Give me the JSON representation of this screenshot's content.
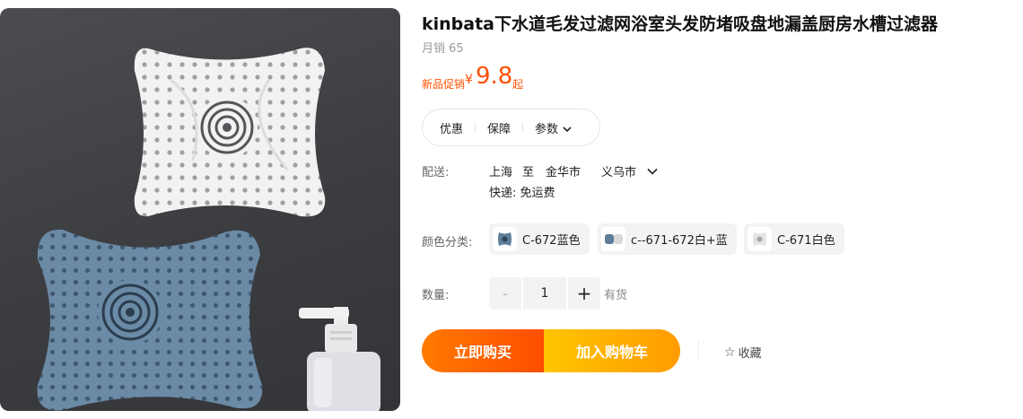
{
  "product": {
    "title": "kinbata下水道毛发过滤网浴室头发防堵吸盘地漏盖厨房水槽过滤器",
    "monthly_sales": "月销 65",
    "image_alt": "product-photo"
  },
  "price": {
    "promo_label": "新品促销",
    "currency": "¥",
    "value": "9.8",
    "suffix": "起",
    "color": "#ff5000"
  },
  "tabs": [
    {
      "label": "优惠"
    },
    {
      "label": "保障"
    },
    {
      "label": "参数"
    }
  ],
  "shipping": {
    "label": "配送:",
    "from": "上海",
    "to_word": "至",
    "city": "金华市",
    "district": "义乌市",
    "fee": "快递: 免运费"
  },
  "color_options": {
    "label": "颜色分类:",
    "items": [
      {
        "label": "C-672蓝色",
        "icon": "blue-filter-thumb"
      },
      {
        "label": "c--671-672白+蓝",
        "icon": "blue-white-filter-thumb"
      },
      {
        "label": "C-671白色",
        "icon": "white-filter-thumb"
      }
    ]
  },
  "quantity": {
    "label": "数量:",
    "minus": "-",
    "value": "1",
    "plus": "+",
    "stock": "有货"
  },
  "actions": {
    "buy_now": "立即购买",
    "add_to_cart": "加入购物车",
    "favorite": "收藏",
    "buy_color": "#ff5a00",
    "cart_color": "#ffb300"
  }
}
